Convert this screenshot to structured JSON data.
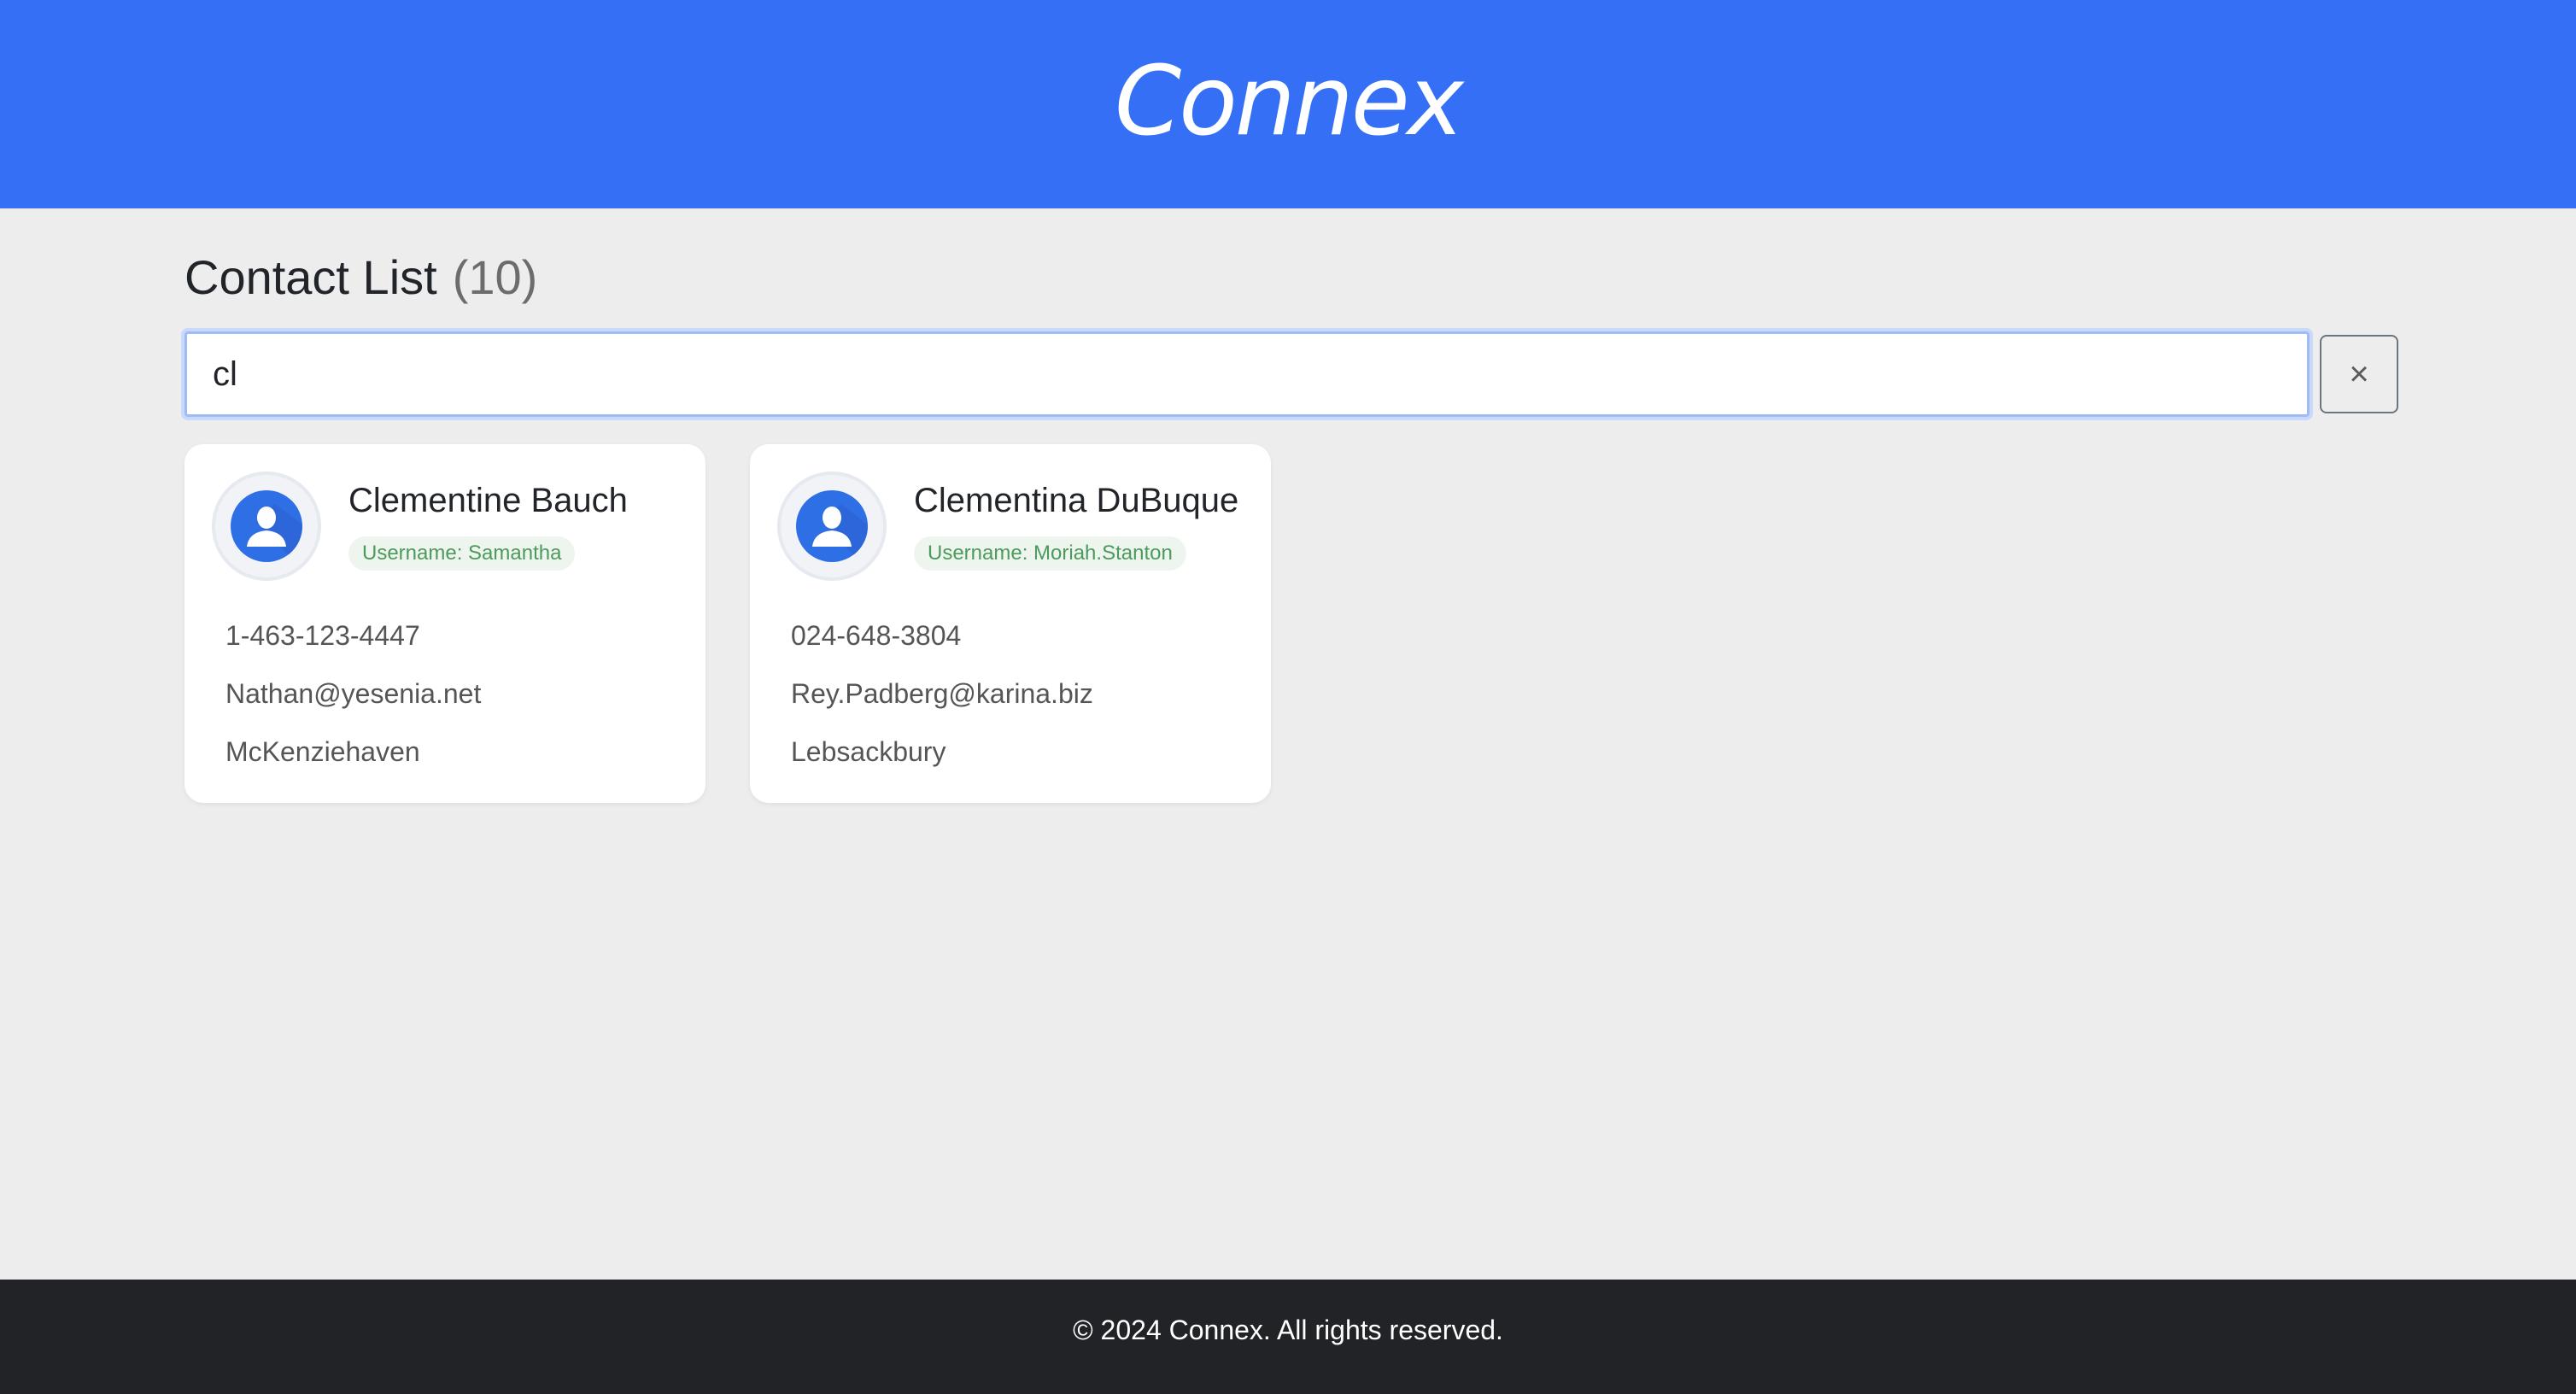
{
  "header": {
    "brand": "Connex"
  },
  "main": {
    "title": "Contact List",
    "count": "(10)",
    "search": {
      "value": "cl",
      "clear_label": "×"
    },
    "contacts": [
      {
        "name": "Clementine Bauch",
        "username": "Username: Samantha",
        "phone": "1-463-123-4447",
        "email": "Nathan@yesenia.net",
        "city": "McKenziehaven"
      },
      {
        "name": "Clementina DuBuque",
        "username": "Username: Moriah.Stanton",
        "phone": "024-648-3804",
        "email": "Rey.Padberg@karina.biz",
        "city": "Lebsackbury"
      }
    ]
  },
  "footer": {
    "text": "© 2024 Connex. All rights reserved."
  },
  "colors": {
    "header_bg": "#346ff6",
    "page_bg": "#ededed",
    "footer_bg": "#212327",
    "badge_text": "#4c9a5c",
    "badge_bg": "#edf5ee",
    "avatar_accent": "#2f6fe6"
  },
  "icons": {
    "avatar": "user-avatar-icon",
    "clear": "close-icon"
  }
}
